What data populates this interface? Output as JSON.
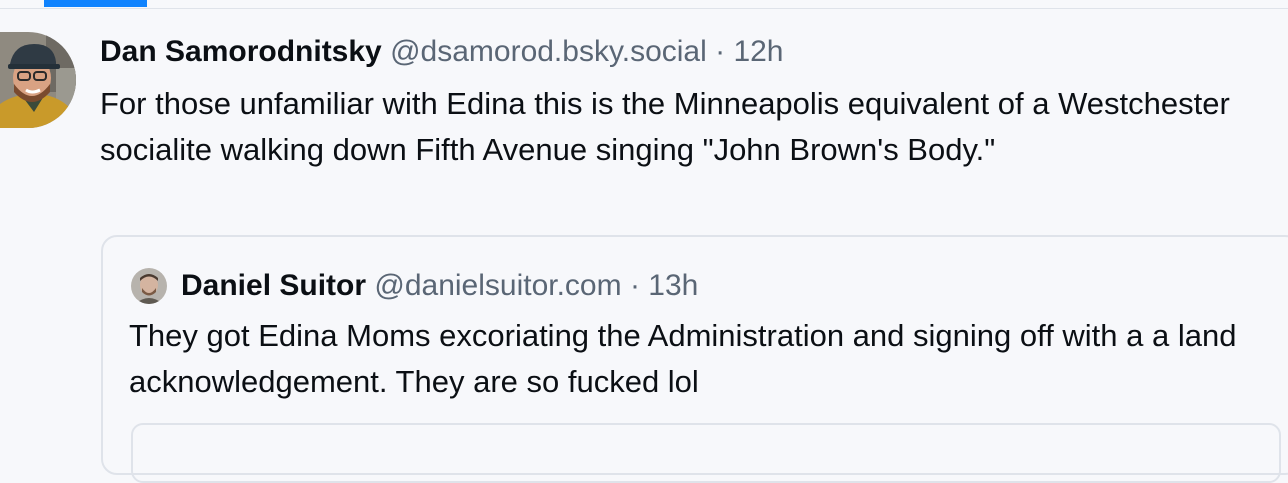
{
  "feed": {
    "active_tab_color": "#1083fe"
  },
  "post": {
    "author": {
      "display_name": "Dan Samorodnitsky",
      "handle": "@dsamorod.bsky.social",
      "avatar_icon": "user-avatar-photo"
    },
    "separator": " · ",
    "timestamp": "12h",
    "text": "For those unfamiliar with Edina this is the Minneapolis equivalent of a Westchester socialite walking down Fifth Avenue singing \"John Brown's Body.\"",
    "quote": {
      "author": {
        "display_name": "Daniel Suitor",
        "handle": "@danielsuitor.com",
        "avatar_icon": "user-avatar-photo"
      },
      "separator": " · ",
      "timestamp": "13h",
      "text": "They got Edina Moms excoriating the Administration and signing off with a a land acknowledgement. They are so fucked lol"
    }
  },
  "colors": {
    "background": "#f7f8fb",
    "text": "#0b0f14",
    "secondary_text": "#5a6675",
    "border": "#dfe3ea",
    "accent": "#1083fe"
  }
}
